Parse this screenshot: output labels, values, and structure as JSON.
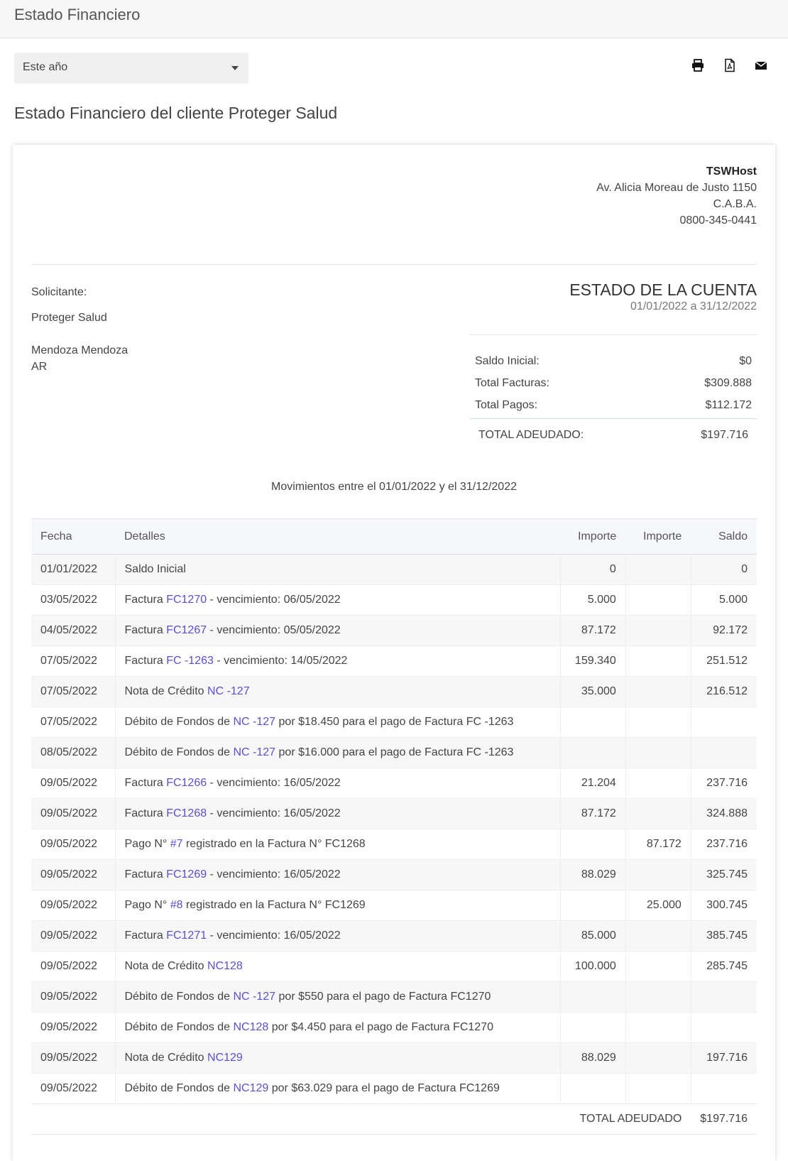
{
  "topbar": {
    "title": "Estado Financiero"
  },
  "toolbar": {
    "period_value": "Este año",
    "icons": [
      "print-icon",
      "pdf-icon",
      "email-icon"
    ]
  },
  "page_heading": "Estado Financiero del cliente Proteger Salud",
  "company": {
    "name": "TSWHost",
    "address": "Av. Alicia Moreau de Justo 1150",
    "city": "C.A.B.A.",
    "phone": "0800-345-0441"
  },
  "requester": {
    "label": "Solicitante:",
    "client": "Proteger Salud",
    "location": "Mendoza Mendoza",
    "country": "AR"
  },
  "account": {
    "title": "ESTADO DE LA CUENTA",
    "range": "01/01/2022 a 31/12/2022"
  },
  "summary": {
    "initial_label": "Saldo Inicial:",
    "initial_value": "$0",
    "invoices_label": "Total Facturas:",
    "invoices_value": "$309.888",
    "payments_label": "Total Pagos:",
    "payments_value": "$112.172",
    "owed_label": "TOTAL ADEUDADO:",
    "owed_value": "$197.716"
  },
  "movements_caption": "Movimientos entre el 01/01/2022 y el 31/12/2022",
  "table": {
    "headers": [
      "Fecha",
      "Detalles",
      "Importe",
      "Importe",
      "Saldo"
    ],
    "rows": [
      {
        "date": "01/01/2022",
        "pre": "Saldo Inicial",
        "link": "",
        "post": "",
        "imp1": "0",
        "imp2": "",
        "saldo": "0"
      },
      {
        "date": "03/05/2022",
        "pre": "Factura ",
        "link": "FC1270",
        "post": " - vencimiento: 06/05/2022",
        "imp1": "5.000",
        "imp2": "",
        "saldo": "5.000"
      },
      {
        "date": "04/05/2022",
        "pre": "Factura ",
        "link": "FC1267",
        "post": " - vencimiento: 05/05/2022",
        "imp1": "87.172",
        "imp2": "",
        "saldo": "92.172"
      },
      {
        "date": "07/05/2022",
        "pre": "Factura ",
        "link": "FC -1263",
        "post": " - vencimiento: 14/05/2022",
        "imp1": "159.340",
        "imp2": "",
        "saldo": "251.512"
      },
      {
        "date": "07/05/2022",
        "pre": "Nota de Crédito ",
        "link": "NC -127",
        "post": "",
        "imp1": "35.000",
        "imp2": "",
        "saldo": "216.512"
      },
      {
        "date": "07/05/2022",
        "pre": "Débito de Fondos de ",
        "link": "NC -127",
        "post": " por $18.450 para el pago de Factura FC -1263",
        "imp1": "",
        "imp2": "",
        "saldo": ""
      },
      {
        "date": "08/05/2022",
        "pre": "Débito de Fondos de ",
        "link": "NC -127",
        "post": " por $16.000 para el pago de Factura FC -1263",
        "imp1": "",
        "imp2": "",
        "saldo": ""
      },
      {
        "date": "09/05/2022",
        "pre": "Factura ",
        "link": "FC1266",
        "post": " - vencimiento: 16/05/2022",
        "imp1": "21.204",
        "imp2": "",
        "saldo": "237.716"
      },
      {
        "date": "09/05/2022",
        "pre": "Factura ",
        "link": "FC1268",
        "post": " - vencimiento: 16/05/2022",
        "imp1": "87.172",
        "imp2": "",
        "saldo": "324.888"
      },
      {
        "date": "09/05/2022",
        "pre": "Pago N° ",
        "link": "#7",
        "post": " registrado en la Factura N° FC1268",
        "imp1": "",
        "imp2": "87.172",
        "saldo": "237.716"
      },
      {
        "date": "09/05/2022",
        "pre": "Factura ",
        "link": "FC1269",
        "post": " - vencimiento: 16/05/2022",
        "imp1": "88.029",
        "imp2": "",
        "saldo": "325.745"
      },
      {
        "date": "09/05/2022",
        "pre": "Pago N° ",
        "link": "#8",
        "post": " registrado en la Factura N° FC1269",
        "imp1": "",
        "imp2": "25.000",
        "saldo": "300.745"
      },
      {
        "date": "09/05/2022",
        "pre": "Factura ",
        "link": "FC1271",
        "post": " - vencimiento: 16/05/2022",
        "imp1": "85.000",
        "imp2": "",
        "saldo": "385.745"
      },
      {
        "date": "09/05/2022",
        "pre": "Nota de Crédito ",
        "link": "NC128",
        "post": "",
        "imp1": "100.000",
        "imp2": "",
        "saldo": "285.745"
      },
      {
        "date": "09/05/2022",
        "pre": "Débito de Fondos de ",
        "link": "NC -127",
        "post": " por $550 para el pago de Factura FC1270",
        "imp1": "",
        "imp2": "",
        "saldo": ""
      },
      {
        "date": "09/05/2022",
        "pre": "Débito de Fondos de ",
        "link": "NC128",
        "post": " por $4.450 para el pago de Factura FC1270",
        "imp1": "",
        "imp2": "",
        "saldo": ""
      },
      {
        "date": "09/05/2022",
        "pre": "Nota de Crédito ",
        "link": "NC129",
        "post": "",
        "imp1": "88.029",
        "imp2": "",
        "saldo": "197.716"
      },
      {
        "date": "09/05/2022",
        "pre": "Débito de Fondos de ",
        "link": "NC129",
        "post": " por $63.029 para el pago de Factura FC1269",
        "imp1": "",
        "imp2": "",
        "saldo": ""
      }
    ],
    "footer_label": "TOTAL ADEUDADO",
    "footer_value": "$197.716"
  },
  "colors": {
    "link": "#5a4fcf",
    "topbar_bg": "#f7f7f7",
    "header_bg": "#f6f7fb"
  }
}
